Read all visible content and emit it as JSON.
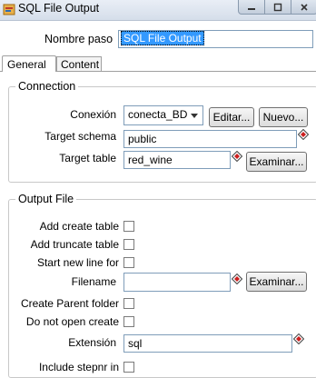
{
  "window": {
    "title": "SQL File Output"
  },
  "step_name": {
    "label": "Nombre paso",
    "value": "SQL File Output"
  },
  "tabs": [
    {
      "label": "General"
    },
    {
      "label": "Content"
    }
  ],
  "connection": {
    "title": "Connection",
    "conexion": {
      "label": "Conexión",
      "value": "conecta_BD",
      "edit_button": "Editar...",
      "new_button": "Nuevo..."
    },
    "target_schema": {
      "label": "Target schema",
      "value": "public"
    },
    "target_table": {
      "label": "Target table",
      "value": "red_wine",
      "browse_button": "Examinar..."
    }
  },
  "output_file": {
    "title": "Output File",
    "add_create_table": {
      "label": "Add create table"
    },
    "add_truncate_table": {
      "label": "Add truncate table"
    },
    "start_new_line": {
      "label": "Start new line for"
    },
    "filename": {
      "label": "Filename",
      "value": "",
      "browse_button": "Examinar..."
    },
    "create_parent_folder": {
      "label": "Create Parent folder"
    },
    "do_not_open_create": {
      "label": "Do not open create"
    },
    "extension": {
      "label": "Extensión",
      "value": "sql"
    },
    "include_stepnr": {
      "label": "Include stepnr in"
    }
  }
}
